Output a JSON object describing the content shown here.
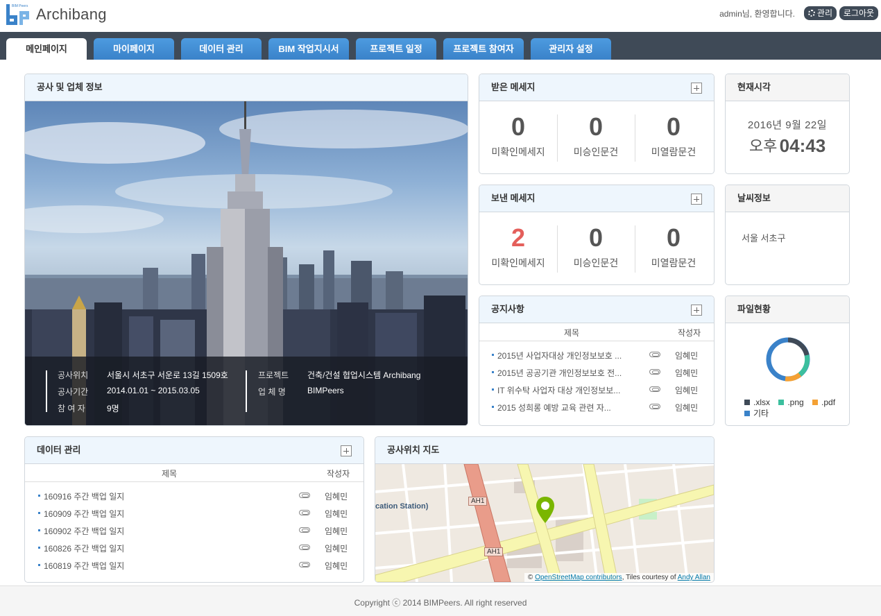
{
  "header": {
    "brand": "Archibang",
    "logo_text": "BIM Peers",
    "welcome": "admin님, 환영합니다.",
    "admin_label": "관리",
    "logout_label": "로그아웃"
  },
  "nav": {
    "tabs": [
      {
        "label": "메인페이지",
        "active": true
      },
      {
        "label": "마이페이지"
      },
      {
        "label": "데이터 관리"
      },
      {
        "label": "BIM 작업지시서"
      },
      {
        "label": "프로젝트 일정"
      },
      {
        "label": "프로젝트 참여자"
      },
      {
        "label": "관리자 설정"
      }
    ]
  },
  "company": {
    "title": "공사 및 업체 정보",
    "location_label": "공사위치",
    "location_value": "서울시 서초구 서운로 13길 1509호",
    "period_label": "공사기간",
    "period_value": "2014.01.01 ~ 2015.03.05",
    "members_label": "참 여 자",
    "members_value": "9명",
    "project_label": "프로젝트",
    "project_value": "건축/건설 협업시스템 Archibang",
    "company_label": "업 체 명",
    "company_value": "BIMPeers"
  },
  "received": {
    "title": "받은 메세지",
    "stats": [
      {
        "value": "0",
        "label": "미확인메세지"
      },
      {
        "value": "0",
        "label": "미승인문건"
      },
      {
        "value": "0",
        "label": "미열람문건"
      }
    ]
  },
  "sent": {
    "title": "보낸 메세지",
    "stats": [
      {
        "value": "2",
        "label": "미확인메세지"
      },
      {
        "value": "0",
        "label": "미승인문건"
      },
      {
        "value": "0",
        "label": "미열람문건"
      }
    ]
  },
  "notice": {
    "title": "공지사항",
    "col_title": "제목",
    "col_author": "작성자",
    "rows": [
      {
        "title": "2015년 사업자대상 개인정보보호 ...",
        "author": "임혜민"
      },
      {
        "title": "2015년 공공기관 개인정보보호 전...",
        "author": "임혜민"
      },
      {
        "title": "IT 위수탁 사업자 대상 개인정보보...",
        "author": "임혜민"
      },
      {
        "title": "2015 성희롱 예방 교육 관련 자...",
        "author": "임혜민"
      }
    ]
  },
  "clock": {
    "title": "현재시각",
    "date": "2016년 9월 22일",
    "ampm": "오후",
    "time": "04:43"
  },
  "weather": {
    "title": "날씨정보",
    "location": "서울 서초구"
  },
  "files": {
    "title": "파일현황",
    "legend": [
      {
        "label": ".xlsx",
        "color": "#3f4a57"
      },
      {
        "label": ".png",
        "color": "#3cbf9e"
      },
      {
        "label": ".pdf",
        "color": "#f4a134"
      },
      {
        "label": "기타",
        "color": "#3a82c9"
      }
    ]
  },
  "data_mgmt": {
    "title": "데이터 관리",
    "col_title": "제목",
    "col_author": "작성자",
    "rows": [
      {
        "title": "160916 주간 백업 일지",
        "author": "임혜민"
      },
      {
        "title": "160909 주간 백업 일지",
        "author": "임혜민"
      },
      {
        "title": "160902 주간 백업 일지",
        "author": "임혜민"
      },
      {
        "title": "160826 주간 백업 일지",
        "author": "임혜민"
      },
      {
        "title": "160819 주간 백업 일지",
        "author": "임혜민"
      }
    ]
  },
  "map": {
    "title": "공사위치 지도",
    "road_label_1": "AH1",
    "road_label_2": "AH1",
    "station_label": "cation Station)",
    "credit_prefix": "©",
    "credit_link_1": "OpenStreetMap contributors",
    "credit_mid": ", Tiles courtesy of",
    "credit_link_2": "Andy Allan"
  },
  "footer": {
    "copyright": "Copyright ⓒ 2014 BIMPeers. All right reserved"
  }
}
